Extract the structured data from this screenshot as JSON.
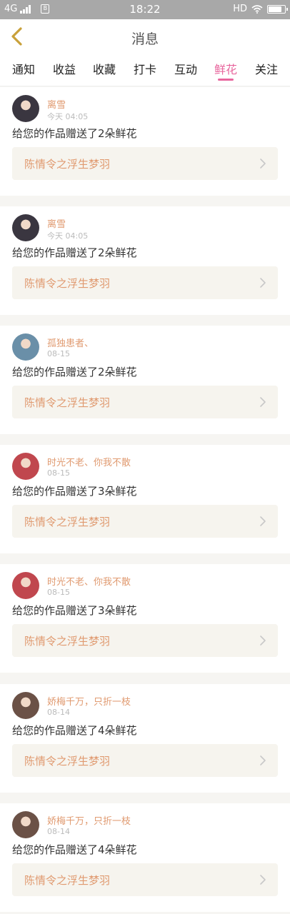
{
  "status_bar": {
    "network": "4G",
    "sim_label": "B",
    "time": "18:22",
    "hd_label": "HD"
  },
  "header": {
    "title": "消息",
    "back_icon": "chevron-left-icon",
    "accent_color": "#e8659d"
  },
  "tabs": [
    {
      "label": "通知"
    },
    {
      "label": "收益"
    },
    {
      "label": "收藏"
    },
    {
      "label": "打卡"
    },
    {
      "label": "互动"
    },
    {
      "label": "鲜花",
      "active": true
    },
    {
      "label": "关注"
    }
  ],
  "messages": [
    {
      "user": "离雪",
      "time": "今天 04:05",
      "text": "给您的作品赠送了2朵鲜花",
      "work": "陈情令之浮生梦羽",
      "avatar_color": "#3a3640"
    },
    {
      "user": "离雪",
      "time": "今天 04:05",
      "text": "给您的作品赠送了2朵鲜花",
      "work": "陈情令之浮生梦羽",
      "avatar_color": "#3a3640"
    },
    {
      "user": "孤独患者、",
      "time": "08-15",
      "text": "给您的作品赠送了2朵鲜花",
      "work": "陈情令之浮生梦羽",
      "avatar_color": "#6a8fa8"
    },
    {
      "user": "时光不老、你我不散",
      "time": "08-15",
      "text": "给您的作品赠送了3朵鲜花",
      "work": "陈情令之浮生梦羽",
      "avatar_color": "#c0474e"
    },
    {
      "user": "时光不老、你我不散",
      "time": "08-15",
      "text": "给您的作品赠送了3朵鲜花",
      "work": "陈情令之浮生梦羽",
      "avatar_color": "#c0474e"
    },
    {
      "user": "娇梅千万，只折一枝",
      "time": "08-14",
      "text": "给您的作品赠送了4朵鲜花",
      "work": "陈情令之浮生梦羽",
      "avatar_color": "#6b5146"
    },
    {
      "user": "娇梅千万，只折一枝",
      "time": "08-14",
      "text": "给您的作品赠送了4朵鲜花",
      "work": "陈情令之浮生梦羽",
      "avatar_color": "#6b5146"
    }
  ]
}
